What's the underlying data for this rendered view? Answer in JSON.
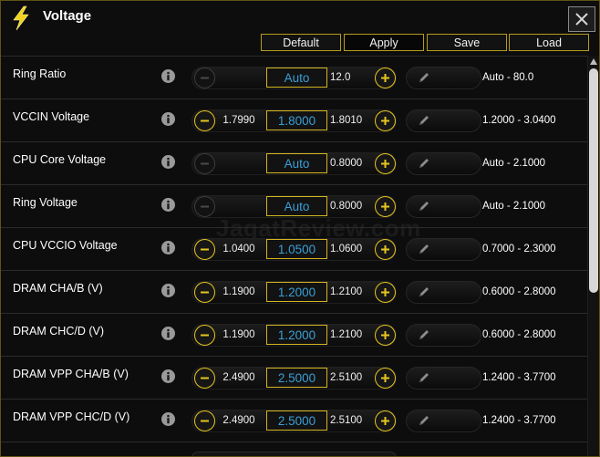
{
  "window": {
    "title": "Voltage",
    "title_icon": "lightning-bolt-icon",
    "close_icon": "close-icon"
  },
  "toolbar": {
    "default_label": "Default",
    "apply_label": "Apply",
    "save_label": "Save",
    "load_label": "Load"
  },
  "colors": {
    "accent": "#e6c51d",
    "value_text": "#3a9fd8",
    "background": "#0d0d0d"
  },
  "watermark": "JagatReview.com",
  "rows": [
    {
      "label": "Ring Ratio",
      "min": "",
      "current": "Auto",
      "max": "12.0",
      "range": "Auto - 80.0",
      "minus_enabled": false
    },
    {
      "label": "VCCIN Voltage",
      "min": "1.7990",
      "current": "1.8000",
      "max": "1.8010",
      "range": "1.2000 - 3.0400",
      "minus_enabled": true
    },
    {
      "label": "CPU Core Voltage",
      "min": "",
      "current": "Auto",
      "max": "0.8000",
      "range": "Auto - 2.1000",
      "minus_enabled": false
    },
    {
      "label": "Ring Voltage",
      "min": "",
      "current": "Auto",
      "max": "0.8000",
      "range": "Auto - 2.1000",
      "minus_enabled": false
    },
    {
      "label": "CPU VCCIO Voltage",
      "min": "1.0400",
      "current": "1.0500",
      "max": "1.0600",
      "range": "0.7000 - 2.3000",
      "minus_enabled": true
    },
    {
      "label": "DRAM CHA/B (V)",
      "min": "1.1900",
      "current": "1.2000",
      "max": "1.2100",
      "range": "0.6000 - 2.8000",
      "minus_enabled": true
    },
    {
      "label": "DRAM CHC/D (V)",
      "min": "1.1900",
      "current": "1.2000",
      "max": "1.2100",
      "range": "0.6000 - 2.8000",
      "minus_enabled": true
    },
    {
      "label": "DRAM VPP CHA/B (V)",
      "min": "2.4900",
      "current": "2.5000",
      "max": "2.5100",
      "range": "1.2400 - 3.7700",
      "minus_enabled": true
    },
    {
      "label": "DRAM VPP CHC/D (V)",
      "min": "2.4900",
      "current": "2.5000",
      "max": "2.5100",
      "range": "1.2400 - 3.7700",
      "minus_enabled": true
    }
  ]
}
